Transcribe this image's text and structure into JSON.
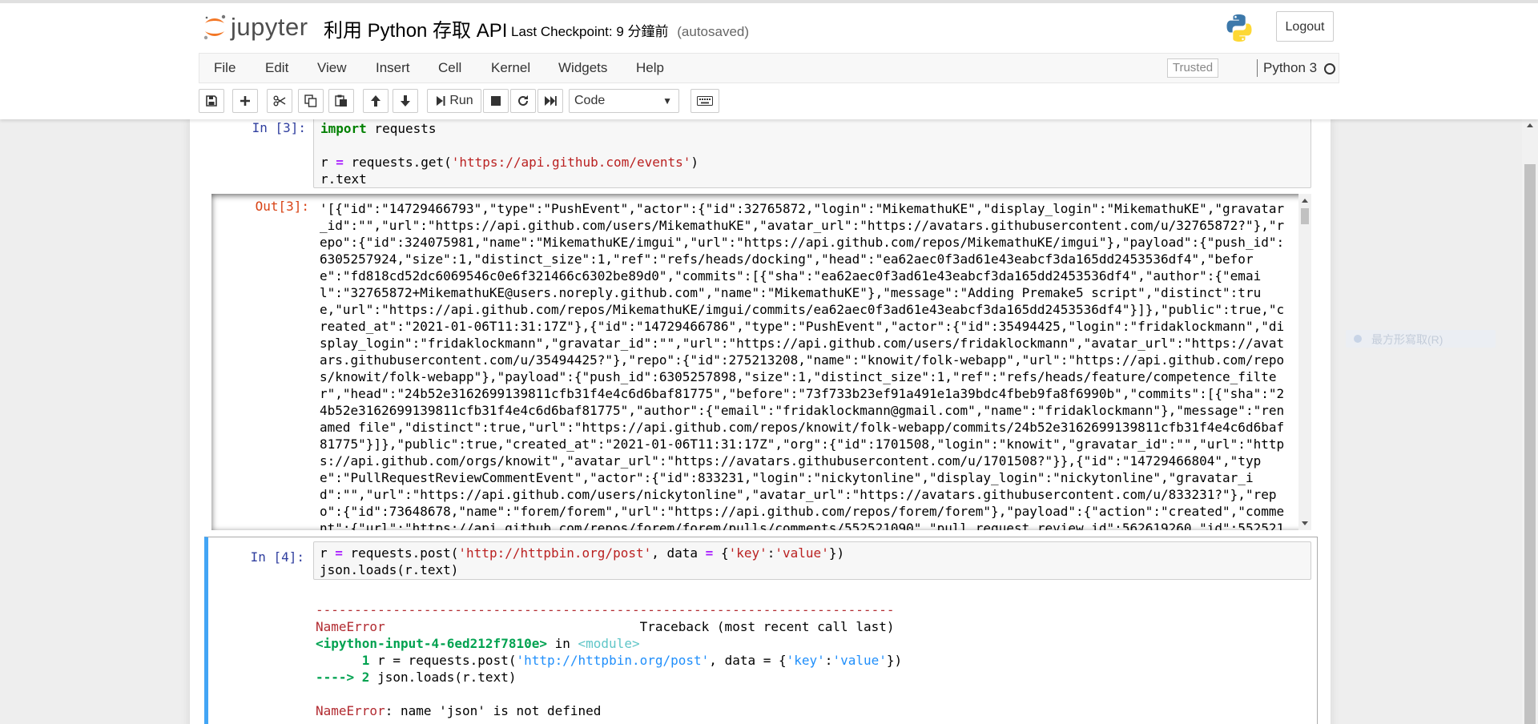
{
  "header": {
    "logo_text": "jupyter",
    "notebook_title": "利用 Python 存取 API",
    "checkpoint_label": "Last Checkpoint: 9 分鐘前",
    "autosaved": "(autosaved)",
    "logout_label": "Logout"
  },
  "menubar": {
    "items": [
      "File",
      "Edit",
      "View",
      "Insert",
      "Cell",
      "Kernel",
      "Widgets",
      "Help"
    ],
    "trusted_label": "Trusted",
    "kernel_name": "Python 3"
  },
  "toolbar": {
    "run_label": "Run",
    "cell_type": "Code",
    "icons": [
      "save-icon",
      "plus-icon",
      "cut-icon",
      "copy-icon",
      "paste-icon",
      "arrow-up-icon",
      "arrow-down-icon",
      "run-icon",
      "stop-icon",
      "restart-icon",
      "fast-forward-icon",
      "keyboard-icon"
    ]
  },
  "cells": {
    "cell3": {
      "in_prompt": "In [3]:",
      "out_prompt": "Out[3]:",
      "code_line1_kw": "import",
      "code_line1_rest": " requests",
      "code_line3_pre": "r ",
      "code_line3_eq": "=",
      "code_line3_mid": " requests.get(",
      "code_line3_str": "'https://api.github.com/events'",
      "code_line3_post": ")",
      "code_line4": "r.text",
      "output_lines": [
        "'[{\"id\":\"14729466793\",\"type\":\"PushEvent\",\"actor\":{\"id\":32765872,\"login\":\"MikemathuKE\",\"display_login\":\"MikemathuKE\",\"gravatar",
        "_id\":\"\",\"url\":\"https://api.github.com/users/MikemathuKE\",\"avatar_url\":\"https://avatars.githubusercontent.com/u/32765872?\"},\"r",
        "epo\":{\"id\":324075981,\"name\":\"MikemathuKE/imgui\",\"url\":\"https://api.github.com/repos/MikemathuKE/imgui\"},\"payload\":{\"push_id\":",
        "6305257924,\"size\":1,\"distinct_size\":1,\"ref\":\"refs/heads/docking\",\"head\":\"ea62aec0f3ad61e43eabcf3da165dd2453536df4\",\"befor",
        "e\":\"fd818cd52dc6069546c0e6f321466c6302be89d0\",\"commits\":[{\"sha\":\"ea62aec0f3ad61e43eabcf3da165dd2453536df4\",\"author\":{\"emai",
        "l\":\"32765872+MikemathuKE@users.noreply.github.com\",\"name\":\"MikemathuKE\"},\"message\":\"Adding Premake5 script\",\"distinct\":tru",
        "e,\"url\":\"https://api.github.com/repos/MikemathuKE/imgui/commits/ea62aec0f3ad61e43eabcf3da165dd2453536df4\"}]},\"public\":true,\"c",
        "reated_at\":\"2021-01-06T11:31:17Z\"},{\"id\":\"14729466786\",\"type\":\"PushEvent\",\"actor\":{\"id\":35494425,\"login\":\"fridaklockmann\",\"di",
        "splay_login\":\"fridaklockmann\",\"gravatar_id\":\"\",\"url\":\"https://api.github.com/users/fridaklockmann\",\"avatar_url\":\"https://avat",
        "ars.githubusercontent.com/u/35494425?\"},\"repo\":{\"id\":275213208,\"name\":\"knowit/folk-webapp\",\"url\":\"https://api.github.com/repo",
        "s/knowit/folk-webapp\"},\"payload\":{\"push_id\":6305257898,\"size\":1,\"distinct_size\":1,\"ref\":\"refs/heads/feature/competence_filte",
        "r\",\"head\":\"24b52e3162699139811cfb31f4e4c6d6baf81775\",\"before\":\"73f733b23ef91a491e1a39bdc4fbeb9fa8f6990b\",\"commits\":[{\"sha\":\"2",
        "4b52e3162699139811cfb31f4e4c6d6baf81775\",\"author\":{\"email\":\"fridaklockmann@gmail.com\",\"name\":\"fridaklockmann\"},\"message\":\"ren",
        "amed file\",\"distinct\":true,\"url\":\"https://api.github.com/repos/knowit/folk-webapp/commits/24b52e3162699139811cfb31f4e4c6d6baf",
        "81775\"}]},\"public\":true,\"created_at\":\"2021-01-06T11:31:17Z\",\"org\":{\"id\":1701508,\"login\":\"knowit\",\"gravatar_id\":\"\",\"url\":\"http",
        "s://api.github.com/orgs/knowit\",\"avatar_url\":\"https://avatars.githubusercontent.com/u/1701508?\"}},{\"id\":\"14729466804\",\"typ",
        "e\":\"PullRequestReviewCommentEvent\",\"actor\":{\"id\":833231,\"login\":\"nickytonline\",\"display_login\":\"nickytonline\",\"gravatar_i",
        "d\":\"\",\"url\":\"https://api.github.com/users/nickytonline\",\"avatar_url\":\"https://avatars.githubusercontent.com/u/833231?\"},\"rep",
        "o\":{\"id\":73648678,\"name\":\"forem/forem\",\"url\":\"https://api.github.com/repos/forem/forem\"},\"payload\":{\"action\":\"created\",\"comme",
        "nt\":{\"url\":\"https://api.github.com/repos/forem/forem/pulls/comments/552521090\",\"pull_request_review_id\":562619260,\"id\":552521"
      ]
    },
    "cell4": {
      "in_prompt": "In [4]:",
      "code1_pre": "r ",
      "code1_eq": "=",
      "code1_mid": " requests.post(",
      "code1_str1": "'http://httpbin.org/post'",
      "code1_mid2": ", data ",
      "code1_eq2": "=",
      "code1_mid3": " {",
      "code1_str2": "'key'",
      "code1_colon": ":",
      "code1_str3": "'value'",
      "code1_post": "})",
      "code2": "json.loads(r.text)",
      "traceback_rule": "---------------------------------------------------------------------------",
      "err_name": "NameError",
      "traceback_label": "Traceback (most recent call last)",
      "input_ref": "<ipython-input-4-6ed212f7810e>",
      "in_word": " in ",
      "module_ref": "<module>",
      "tb_line1_no": "      1",
      "tb_line1_code_pre": " r = requests.post(",
      "tb_line1_str1": "'http://httpbin.org/post'",
      "tb_line1_mid": ", data = {",
      "tb_line1_str2": "'key'",
      "tb_line1_colon": ":",
      "tb_line1_str3": "'value'",
      "tb_line1_post": "})",
      "tb_arrow": "----> 2",
      "tb_line2_code": " json.loads(r.text)",
      "err_message": ": name 'json' is not defined"
    }
  },
  "ghost_label": "最方形寫取(R)",
  "colors": {
    "accent": "#42a5f5",
    "in_prompt": "#303f9f",
    "out_prompt": "#d84315",
    "error_red": "#b22b31",
    "string": "#ba2121",
    "keyword": "#008000",
    "operator": "#aa22ff"
  }
}
